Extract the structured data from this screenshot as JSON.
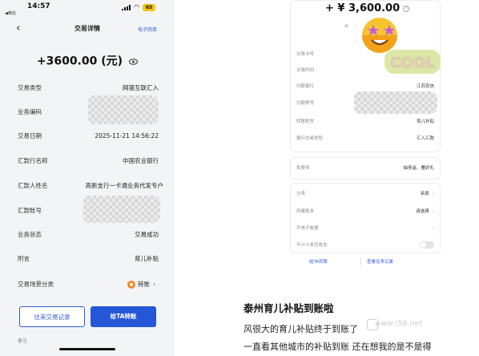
{
  "left": {
    "status_bar": {
      "time": "14:57",
      "back_app": "◀微信",
      "battery": "65"
    },
    "nav": {
      "title": "交易详情",
      "receipt_link": "电子回单"
    },
    "amount": "+3600.00 (元)",
    "rows": [
      {
        "label": "交易类型",
        "value": "网银互联汇入"
      },
      {
        "label": "业务编码",
        "value": ""
      },
      {
        "label": "交易日期",
        "value": "2025-11-21 14:56:22"
      },
      {
        "label": "汇款行名称",
        "value": "中国农业银行"
      },
      {
        "label": "汇款人姓名",
        "value": "高新支行一卡通业务代发专户"
      },
      {
        "label": "汇款账号",
        "value": ""
      },
      {
        "label": "业务状态",
        "value": "交易成功"
      },
      {
        "label": "附言",
        "value": "育儿补贴"
      },
      {
        "label": "交易场景分类",
        "value": "转账"
      }
    ],
    "buttons": {
      "history": "往来交易记录",
      "give": "给TA转账"
    },
    "cut_label": "备注"
  },
  "right": {
    "amount": "+ ¥ 3,600.00",
    "sub_cut": "余",
    "rows": [
      {
        "label": "交易卡号",
        "value": ""
      },
      {
        "label": "交易时间",
        "value": ""
      },
      {
        "label": "付款银行",
        "value": "江苏农信"
      },
      {
        "label": "付款账号",
        "value": ""
      },
      {
        "label": "转账附言",
        "value": "育儿补贴"
      },
      {
        "label": "银行交易类型",
        "value": "汇入汇款"
      }
    ],
    "mid_row": {
      "label": "免费领",
      "value": "抽青盒、雁好礼"
    },
    "bottom_rows": [
      {
        "label": "分类",
        "value": "亲朋"
      },
      {
        "label": "所属账本",
        "value": "请选择"
      },
      {
        "label": "开电子收据",
        "value": ""
      },
      {
        "label": "不计入本月收支",
        "value": ""
      }
    ],
    "buttons": {
      "give": "给TA转账",
      "history": "查看往来记录"
    },
    "sticker_text": "COOL",
    "caption": {
      "title": "泰州育儿补贴到账啦",
      "line1": "风很大的育儿补贴终于到账了",
      "line2": "一直看其他城市的补贴到账 还在想我的是不是得"
    },
    "watermark": "www.i56.net"
  },
  "colors": {
    "accent_blue": "#2457d6",
    "link_blue": "#2f5bd8",
    "battery_yellow": "#f5c400",
    "transfer_orange": "#f08a24"
  }
}
